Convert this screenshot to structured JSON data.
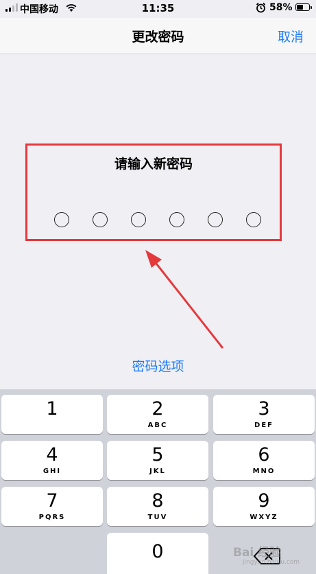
{
  "status_bar": {
    "carrier": "中国移动",
    "time": "11:35",
    "battery": "58%",
    "battery_level": 0.58,
    "icons": [
      "signal-icon",
      "wifi-icon",
      "alarm-icon",
      "battery-icon"
    ]
  },
  "nav": {
    "title": "更改密码",
    "cancel": "取消"
  },
  "passcode": {
    "prompt": "请输入新密码",
    "digits_entered": 0,
    "digits_total": 6
  },
  "options_link": "密码选项",
  "keypad": {
    "keys": [
      {
        "digit": "1",
        "letters": ""
      },
      {
        "digit": "2",
        "letters": "ABC"
      },
      {
        "digit": "3",
        "letters": "DEF"
      },
      {
        "digit": "4",
        "letters": "GHI"
      },
      {
        "digit": "5",
        "letters": "JKL"
      },
      {
        "digit": "6",
        "letters": "MNO"
      },
      {
        "digit": "7",
        "letters": "PQRS"
      },
      {
        "digit": "8",
        "letters": "TUV"
      },
      {
        "digit": "9",
        "letters": "WXYZ"
      },
      {
        "digit": "0",
        "letters": ""
      }
    ]
  },
  "watermark": {
    "text": "Bai 经验",
    "sub": "jingyan.baidu.com"
  },
  "colors": {
    "accent": "#1f7cf6",
    "highlight": "#e5383b",
    "keypad_bg": "#cfd2d9",
    "screen_bg": "#efeff4"
  }
}
